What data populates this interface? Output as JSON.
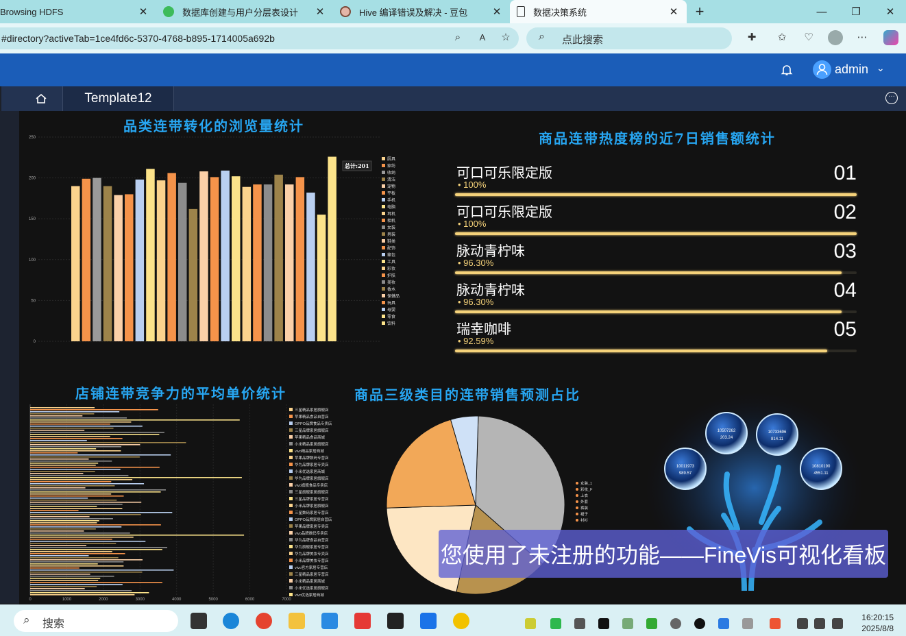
{
  "browser": {
    "tabs": [
      {
        "label": "Browsing HDFS",
        "icon": "none",
        "active": false
      },
      {
        "label": "数据库创建与用户分层表设计",
        "icon": "leaf-icon",
        "active": false
      },
      {
        "label": "Hive 编译错误及解决 - 豆包",
        "icon": "doubao-icon",
        "active": false
      },
      {
        "label": "数据决策系统",
        "icon": "page-icon",
        "active": true
      }
    ],
    "url": "#directory?activeTab=1ce4fd6c-5370-4768-b895-1714005a692b",
    "search_placeholder": "点此搜索"
  },
  "appbar": {
    "user": "admin"
  },
  "template_tab": "Template12",
  "panels": {
    "bar_title": "品类连带转化的浏览量统计",
    "rank_title": "商品连带热度榜的近7日销售额统计",
    "hbar_title": "店铺连带竞争力的平均单价统计",
    "pie_title": "商品三级类目的连带销售预测占比"
  },
  "ranking": [
    {
      "name": "可口可乐限定版",
      "pct_label": "• 100%",
      "pct": 100,
      "rank": "01"
    },
    {
      "name": "可口可乐限定版",
      "pct_label": "• 100%",
      "pct": 100,
      "rank": "02"
    },
    {
      "name": "脉动青柠味",
      "pct_label": "• 96.30%",
      "pct": 96.3,
      "rank": "03"
    },
    {
      "name": "脉动青柠味",
      "pct_label": "• 96.30%",
      "pct": 96.3,
      "rank": "04"
    },
    {
      "name": "瑞幸咖啡",
      "pct_label": "• 92.59%",
      "pct": 92.59,
      "rank": "05"
    }
  ],
  "tree_bubbles": [
    {
      "id": "10507262",
      "val": "203.24"
    },
    {
      "id": "10733696",
      "val": "814.11"
    },
    {
      "id": "10011973",
      "val": "989.57"
    },
    {
      "id": "10810190",
      "val": "4551.11"
    }
  ],
  "watermark": "您使用了未注册的功能——FineVis可视化看板",
  "taskbar": {
    "search": "搜索",
    "time": "16:20:15",
    "date": "2025/8/8"
  },
  "chart_data": [
    {
      "type": "bar",
      "title": "品类连带转化的浏览量统计",
      "ylim": [
        0,
        250
      ],
      "yticks": [
        0,
        50,
        100,
        150,
        200,
        250
      ],
      "tooltip": "总计:201",
      "categories": [
        "厨具",
        "家纺",
        "收纳",
        "清洁",
        "宠物",
        "平板",
        "手机",
        "电脑",
        "耳机",
        "相机",
        "女装",
        "男装",
        "鞋类",
        "配饰",
        "箱包",
        "工具",
        "彩妆",
        "护肤",
        "美妆",
        "香水",
        "保健品",
        "玩具",
        "母婴",
        "零食",
        "饮料"
      ],
      "values": [
        190,
        199,
        200,
        190,
        179,
        180,
        198,
        211,
        197,
        206,
        194,
        162,
        208,
        201,
        209,
        202,
        189,
        192,
        192,
        204,
        192,
        201,
        182,
        155,
        226
      ],
      "colors": [
        "#fbd38d",
        "#f5934a",
        "#9a9a9a",
        "#9d834a",
        "#fbd0a8",
        "#f5934a",
        "#b9cff0",
        "#fce38a",
        "#fbd38d",
        "#f5934a",
        "#8c8c8c",
        "#9d834a",
        "#fbd0a8",
        "#f5934a",
        "#b9cff0",
        "#fce38a",
        "#fbd38d",
        "#f5934a",
        "#8c8c8c",
        "#9d834a",
        "#fbd0a8",
        "#f5934a",
        "#b9cff0",
        "#fce38a",
        "#fce38a"
      ]
    },
    {
      "type": "bar",
      "orientation": "horizontal",
      "title": "店铺连带竞争力的平均单价统计",
      "xlim": [
        0,
        7000
      ],
      "xticks": [
        0,
        1000,
        2000,
        3000,
        4000,
        5000,
        6000,
        7000
      ],
      "legend": [
        "三星精品家居旗舰店",
        "苹果精品食品自营店",
        "OPPO品牌食品专卖店",
        "三星品牌家居旗舰店",
        "苹果精品食品商城",
        "小米精品家居旗舰店",
        "vivo精品家居商城",
        "苹果品牌数码专营店",
        "华为品牌家居专卖店",
        "小米优选家居商城",
        "华为品牌家居旗舰店",
        "vivo旗舰食品专卖店",
        "三星旗舰家居旗舰店",
        "三星品牌家居专营店",
        "小米品牌家居旗舰店",
        "三星数码家居专营店",
        "OPPO品牌家居自营店",
        "苹果品牌家居专卖店",
        "vivo品牌数码专卖店",
        "华为品牌食品自营店",
        "华为旗舰家居专营店",
        "华为品牌美妆专卖店",
        "小米品牌美妆专营店",
        "vivo官方家居专营店",
        "三星精品家居专营店",
        "小米精品家居商城",
        "小米优选家居旗舰店",
        "vivo优选家居商城"
      ],
      "values": [
        3200,
        3800,
        2900,
        2300,
        2100,
        4400,
        5900,
        3100,
        2700,
        4200,
        3500,
        2600,
        3900,
        4100,
        2800,
        3600,
        2500,
        4300,
        3300,
        3000,
        2400,
        3700,
        2200,
        4000,
        3400,
        2000,
        3100,
        2900
      ]
    },
    {
      "type": "pie",
      "title": "商品三级类目的连带销售预测占比",
      "legend": [
        "女装_1",
        "彩妆_F",
        "上衣",
        "外套",
        "裤装",
        "裙子",
        "衬衫"
      ],
      "values": [
        36,
        17,
        21,
        21,
        5
      ],
      "colors": [
        "#b5b5b5",
        "#b8924e",
        "#fde6c3",
        "#f2a858",
        "#cfe1f7"
      ]
    }
  ]
}
